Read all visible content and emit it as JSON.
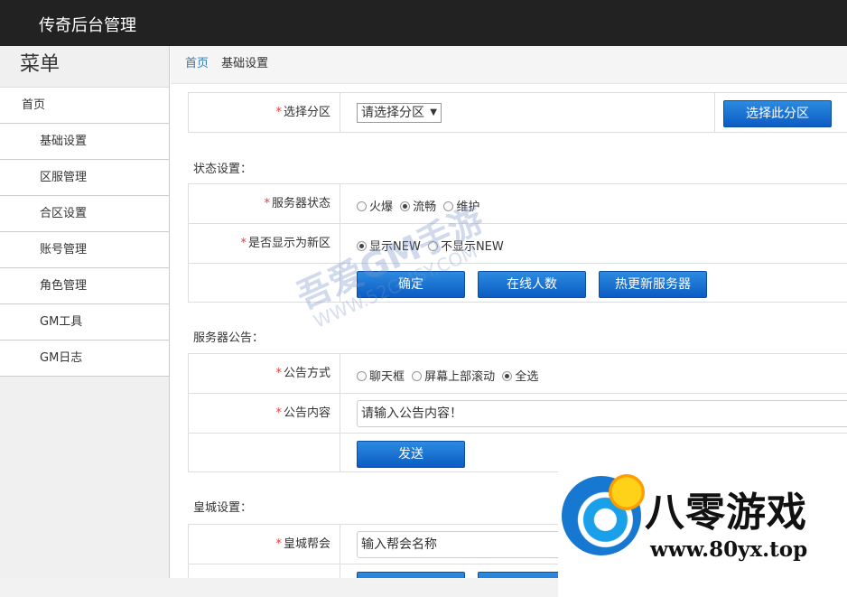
{
  "app": {
    "title": "传奇后台管理"
  },
  "sidebar": {
    "heading": "菜单",
    "items": [
      {
        "label": "首页"
      },
      {
        "label": "基础设置"
      },
      {
        "label": "区服管理"
      },
      {
        "label": "合区设置"
      },
      {
        "label": "账号管理"
      },
      {
        "label": "角色管理"
      },
      {
        "label": "GM工具"
      },
      {
        "label": "GM日志"
      }
    ]
  },
  "breadcrumb": {
    "home": "首页",
    "current": "基础设置"
  },
  "zone": {
    "required": "*",
    "label": "选择分区",
    "select_value": "请选择分区",
    "button": "选择此分区"
  },
  "status": {
    "section_title": "状态设置：",
    "server_state_label": "服务器状态",
    "server_state_options": [
      "火爆",
      "流畅",
      "维护"
    ],
    "server_state_selected": "流畅",
    "new_label": "是否显示为新区",
    "new_options": [
      "显示NEW",
      "不显示NEW"
    ],
    "new_selected": "显示NEW",
    "buttons": {
      "confirm": "确定",
      "online": "在线人数",
      "hot_update": "热更新服务器"
    }
  },
  "notice": {
    "section_title": "服务器公告：",
    "mode_label": "公告方式",
    "mode_options": [
      "聊天框",
      "屏幕上部滚动",
      "全选"
    ],
    "mode_selected": "全选",
    "content_label": "公告内容",
    "content_value": "请输入公告内容！",
    "send_button": "发送"
  },
  "castle": {
    "section_title": "皇城设置：",
    "guild_label": "皇城帮会",
    "guild_value": "输入帮会名称"
  },
  "overlay": {
    "watermark_main": "吾爱GM手游",
    "watermark_url": "WWW.52GMSY.COM",
    "logo_text": "八零游戏",
    "logo_url": "www.80yx.top"
  },
  "colors": {
    "topbar": "#222222",
    "button": "#0b5cc4",
    "required": "#e4393c",
    "link": "#337ab7"
  }
}
